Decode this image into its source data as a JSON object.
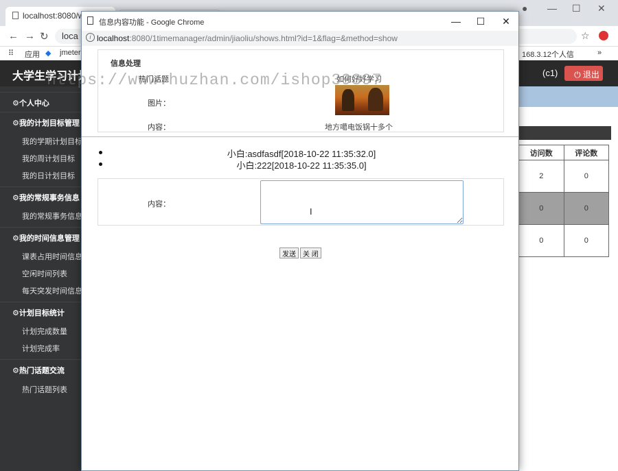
{
  "bg_browser": {
    "tab_title": "localhost:8080/w",
    "url_prefix": "loca",
    "bookmarks": {
      "apps": "应用",
      "jmeter": "jmeter",
      "right": "168.3.12个人信"
    }
  },
  "app": {
    "title": "大学生学习计划与",
    "user": "(c1)",
    "logout": "退出"
  },
  "sidebar": {
    "groups": [
      {
        "label": "个人中心",
        "items": []
      },
      {
        "label": "我的计划目标管理",
        "items": [
          "我的学期计划目标",
          "我的周计划目标",
          "我的日计划目标"
        ]
      },
      {
        "label": "我的常规事务信息",
        "items": [
          "我的常规事务信息"
        ]
      },
      {
        "label": "我的时间信息管理",
        "items": [
          "课表占用时间信息",
          "空闲时间列表",
          "每天突发时间信息"
        ]
      },
      {
        "label": "计划目标统计",
        "items": [
          "计划完成数量",
          "计划完成率"
        ]
      },
      {
        "label": "热门话题交流",
        "items": [
          "热门话题列表"
        ]
      }
    ]
  },
  "table": {
    "headers": [
      "访问数",
      "评论数"
    ],
    "rows": [
      [
        "2",
        "0"
      ],
      [
        "0",
        "0"
      ],
      [
        "0",
        "0"
      ]
    ]
  },
  "popup": {
    "window_title": "信息内容功能 - Google Chrome",
    "url_host": "localhost",
    "url_rest": ":8080/1timemanager/admin/jiaoliu/shows.html?id=1&flag=&method=show",
    "section_title": "信息处理",
    "fields": {
      "topic_label": "热门话题",
      "topic_value": "如何好好学习",
      "image_label": "图片：",
      "content_label": "内容：",
      "content_value": "地方噶电饭锅十多个"
    },
    "comments": [
      "小白:asdfasdf[2018-10-22 11:35:32.0]",
      "小白:222[2018-10-22 11:35:35.0]"
    ],
    "reply_label": "内容：",
    "send": "发送",
    "close": "关 闭"
  },
  "watermark": "https://www.huzhan.com/ishop39397"
}
